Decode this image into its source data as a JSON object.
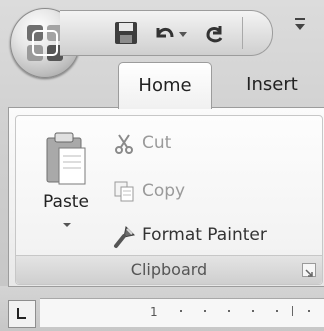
{
  "quick_access": {
    "icons": [
      "save-icon",
      "undo-icon",
      "redo-icon",
      "customize-icon"
    ]
  },
  "tabs": [
    {
      "label": "Home",
      "active": true
    },
    {
      "label": "Insert",
      "active": false
    }
  ],
  "clipboard_group": {
    "title": "Clipboard",
    "paste_label": "Paste",
    "commands": [
      {
        "label": "Cut",
        "icon": "scissors-icon",
        "enabled": false
      },
      {
        "label": "Copy",
        "icon": "copy-icon",
        "enabled": false
      },
      {
        "label": "Format Painter",
        "icon": "paintbrush-icon",
        "enabled": true
      }
    ]
  },
  "ruler": {
    "number": "1"
  }
}
